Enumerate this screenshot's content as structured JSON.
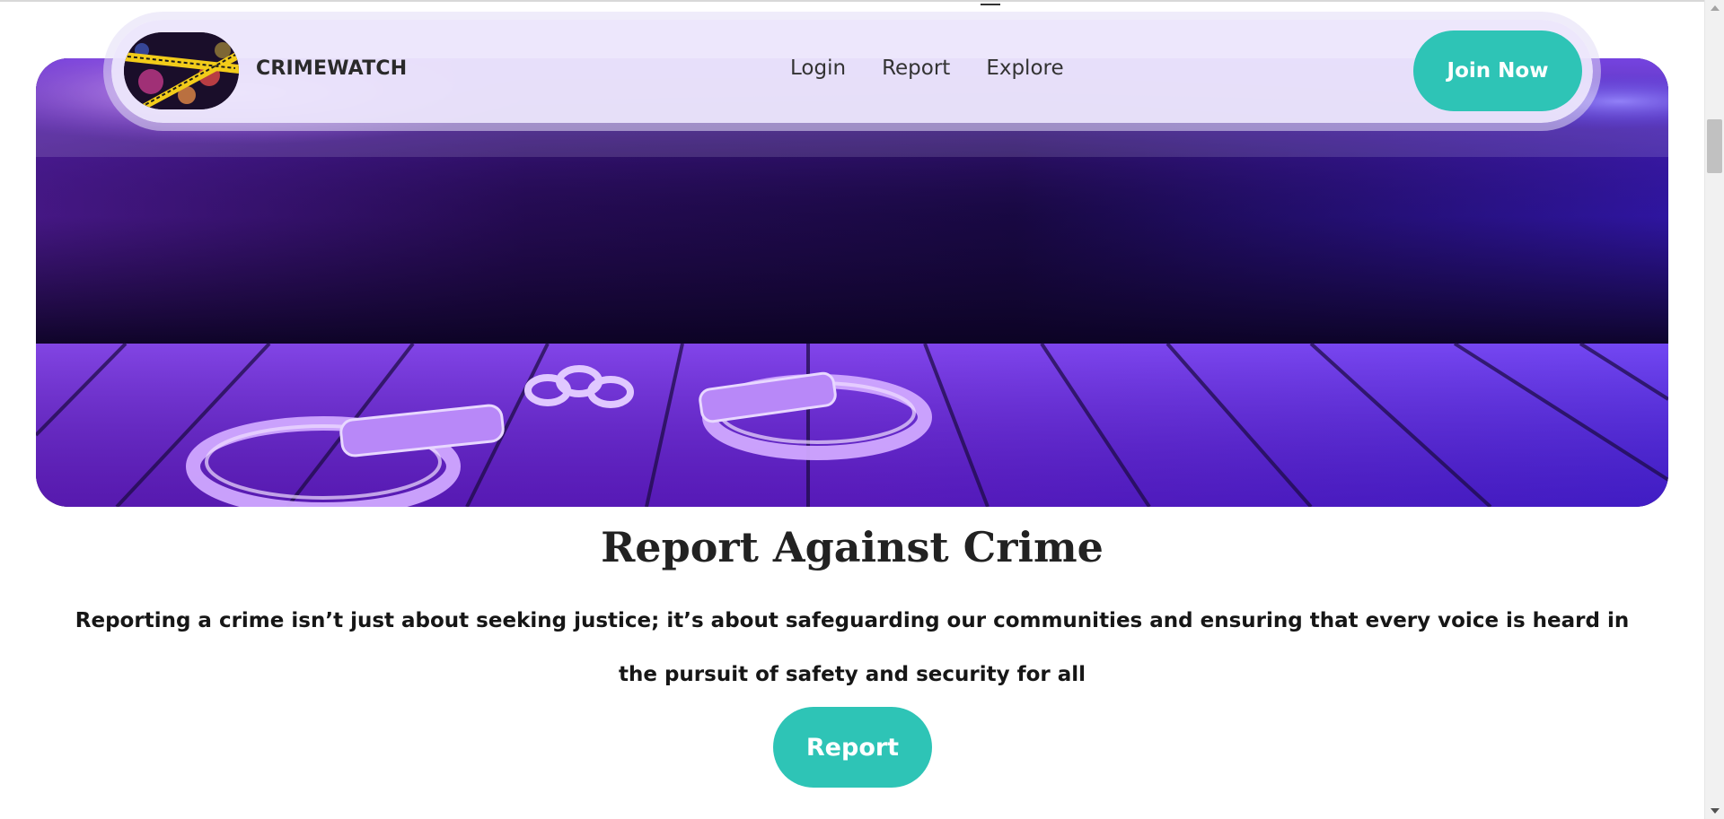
{
  "header": {
    "brand": "CRIMEWATCH",
    "logo_alt": "police line tape logo",
    "nav": [
      {
        "label": "Login"
      },
      {
        "label": "Report"
      },
      {
        "label": "Explore"
      }
    ],
    "cta_label": "Join Now"
  },
  "hero": {
    "image": "handcuffs-on-wooden-table-purple"
  },
  "main": {
    "title": "Report Against Crime",
    "description": "Reporting a crime isn’t just about seeking justice; it’s about safeguarding our communities and ensuring that every voice is heard in the pursuit of safety and security for all",
    "button_label": "Report"
  },
  "colors": {
    "accent": "#2ec4b6",
    "hero_purple": "#6a1ee0",
    "hero_blue": "#3a1cf0",
    "text_dark": "#222222"
  }
}
